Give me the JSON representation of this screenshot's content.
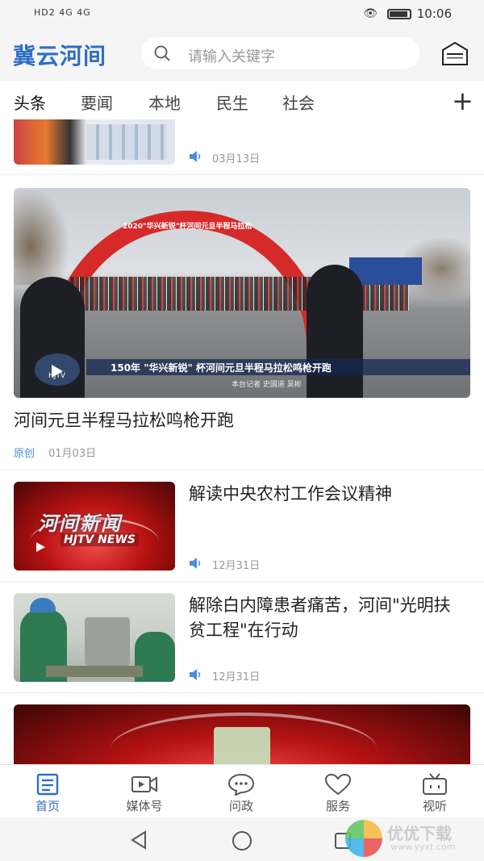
{
  "statusbar": {
    "left": "HD2 4G 4G",
    "time": "10:06"
  },
  "header": {
    "logo": "冀云河间",
    "search_placeholder": "请输入关键字"
  },
  "tabs": [
    "头条",
    "要闻",
    "本地",
    "民生",
    "社会"
  ],
  "articles": [
    {
      "date": "03月13日"
    },
    {
      "title": "河间元旦半程马拉松鸣枪开跑",
      "tag": "原创",
      "date": "01月03日",
      "banner": "2020\"华兴新锐\"杯河间元旦半程马拉松",
      "caption": "150年 \"华兴新锐\" 杯河间元旦半程马拉松鸣枪开跑",
      "sub": "本台记者  史国道  吴彬",
      "channel": "HJTV"
    },
    {
      "title": "解读中央农村工作会议精神",
      "date": "12月31日",
      "thumb_text": "河间新闻",
      "thumb_sub": "HJTV NEWS"
    },
    {
      "title": "解除白内障患者痛苦，河间\"光明扶贫工程\"在行动",
      "date": "12月31日"
    }
  ],
  "bottomnav": [
    "首页",
    "媒体号",
    "问政",
    "服务",
    "视听"
  ],
  "watermark": {
    "text": "优优下载",
    "url": "www.yyxt.com"
  },
  "colors": {
    "accent": "#2e6fc4",
    "arch": "#d62a2a"
  }
}
